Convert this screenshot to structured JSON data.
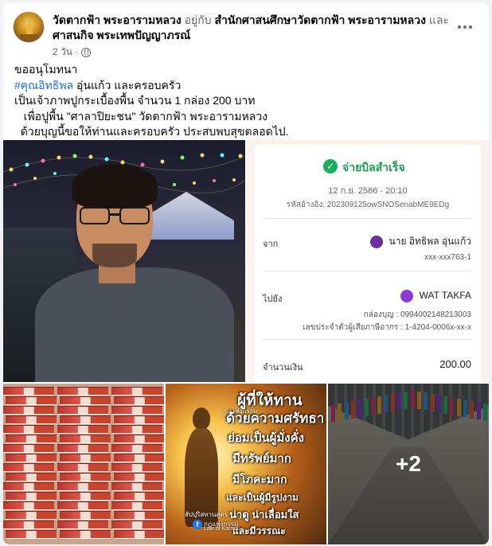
{
  "post": {
    "page_name": "วัดตากฟ้า พระอารามหลวง",
    "with_text": "อยู่กับ",
    "tagged_1": "สำนักศาสนศึกษาวัดตากฟ้า พระอารามหลวง",
    "and_text": "และ",
    "tagged_2": "ศาสนกิจ พระเทพปัญญาภรณ์",
    "time": "2 วัน ·",
    "body_line1": "ขออนุโมทนา",
    "hashtag": "#คุณอิทธิพล",
    "body_line2_rest": " อุ่นแก้ว และครอบครัว",
    "body_line3": "เป็นเจ้าภาพปูกระเบื้องพื้น จำนวน 1 กล่อง 200 บาท",
    "body_line4": "   เพื่อปูพื้น \"ศาลาปิยะชน\" วัดตากฟ้า พระอารามหลวง",
    "body_line5": "  ด้วยบุญนี้ขอให้ท่านและครอบครัว ประสบพบสุขตลอดไป."
  },
  "receipt": {
    "title": "จ่ายบิลสำเร็จ",
    "date": "12 ก.ย. 2566 - 20:10",
    "ref": "รหัสอ้างอิง: 202309125owSNOSenabME9EDg",
    "from_label": "จาก",
    "from_name": "นาย อิทธิพล อุ่นแก้ว",
    "from_account": "xxx-xxx763-1",
    "to_label": "ไปยัง",
    "to_name": "WAT TAKFA",
    "to_box": "กล่องบุญ : 0994002148213003",
    "to_taxid": "เลขประจำตัวผู้เสียภาษีอากร : 1-4204-0006x-xx-x",
    "amount_label": "จำนวนเงิน",
    "amount_value": "200.00"
  },
  "poster": {
    "line1": "ผู้ที่ให้ทาน",
    "line2": "ด้วยความศรัทธา",
    "line3": "ย่อมเป็นผู้มั่งคั่ง",
    "line4": "มีทรัพย์มาก",
    "line5": "มีโภคะมาก",
    "line6": "และเป็นผู้มีรูปงาม",
    "line7": "น่าดู น่าเลื่อมใส",
    "line8": "และมีวรรณะ",
    "watermark1": "กฎแห่งกรรม",
    "watermark2": "Law of Karma",
    "source": "สัปปุริสทานสูตร",
    "fb_name": "กฎแห่งกรรม",
    "fb_sub": "Law of Karma"
  },
  "more_photos": "+2",
  "colors": {
    "hashtag": "#216fdb",
    "success": "#1aae5c",
    "muted": "#65676b"
  }
}
